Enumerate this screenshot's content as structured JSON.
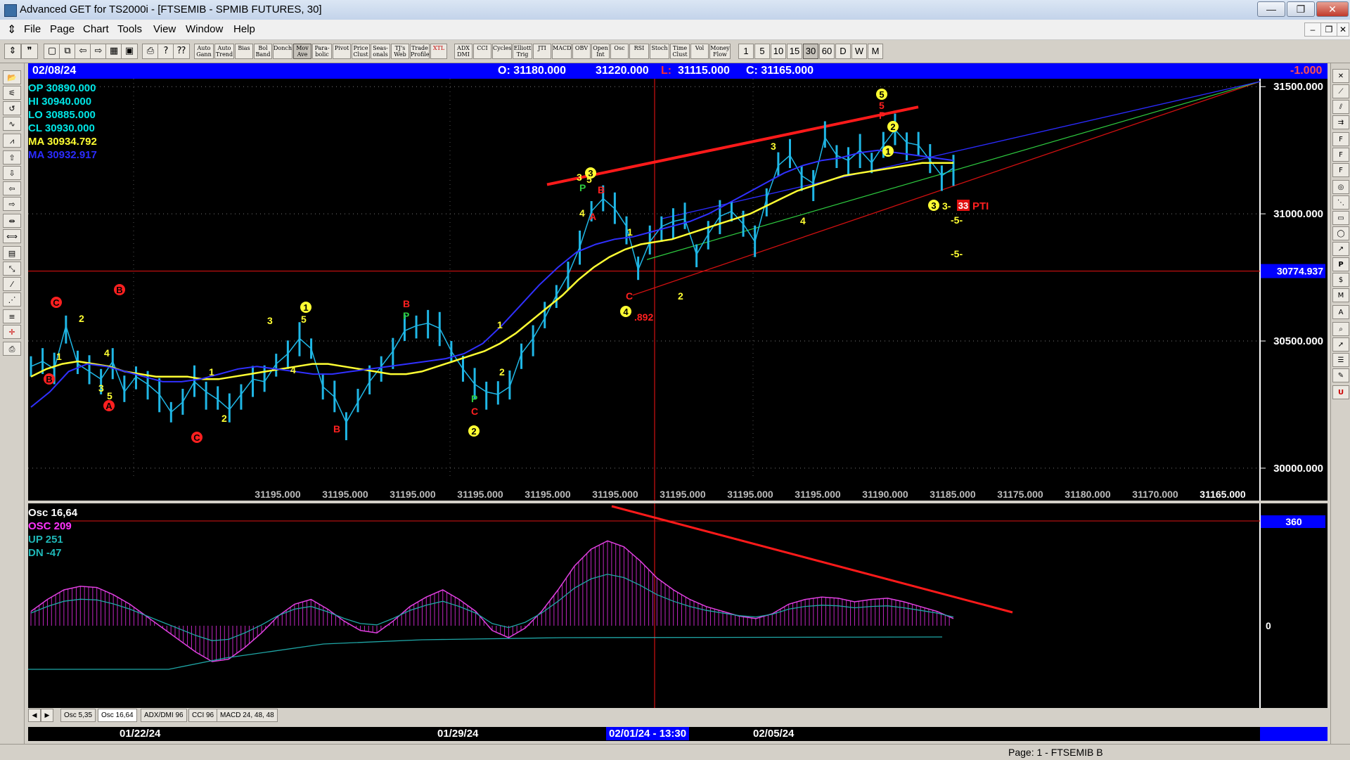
{
  "window": {
    "title": "Advanced GET for TS2000i - [FTSEMIB - SPMIB FUTURES, 30]",
    "min": "—",
    "max": "❐",
    "close": "✕"
  },
  "menu": {
    "items": [
      "File",
      "Page",
      "Chart",
      "Tools",
      "View",
      "Window",
      "Help"
    ],
    "mdi": [
      "–",
      "❐",
      "✕"
    ]
  },
  "toolbar": {
    "buttons": [
      "Auto Gann",
      "Auto Trend",
      "Bias",
      "Bol Band",
      "Donch",
      "Mov Ave",
      "Para-bolic",
      "Pivot",
      "Price Clust",
      "Seas-onals",
      "TJ's Web",
      "Trade Profile",
      "XTL",
      "ADX DMI",
      "CCI",
      "Cycles",
      "Elliott Trig",
      "JTI",
      "MACD",
      "OBV",
      "Open Int",
      "Osc",
      "RSI",
      "Stoch",
      "Time Clust",
      "Vol",
      "Money Flow"
    ],
    "timeframes": [
      "1",
      "5",
      "10",
      "15",
      "30",
      "60",
      "D",
      "W",
      "M"
    ],
    "active_timeframe": "30"
  },
  "infobar": {
    "date": "02/08/24",
    "open": "O: 31180.000",
    "high": "31220.000",
    "low_label": "L:",
    "low": "31115.000",
    "close": "C: 31165.000",
    "change": "-1.000"
  },
  "databox": {
    "op": "OP  30890.000",
    "hi": "HI   30940.000",
    "lo": "LO  30885.000",
    "cl": "CL  30930.000",
    "ma1": "MA  30934.792",
    "ma2": "MA  30932.917"
  },
  "chart_data": {
    "type": "line",
    "title": "",
    "y_axis_ticks": [
      "31500.000",
      "31000.000",
      "30500.000",
      "30000.000"
    ],
    "ylim": [
      29950,
      31520
    ],
    "cursor_price": "30774.937",
    "bottom_price_labels": [
      "31195.000",
      "31195.000",
      "31195.000",
      "31195.000",
      "31195.000",
      "31195.000",
      "31195.000",
      "31195.000",
      "31195.000",
      "31190.000",
      "31185.000",
      "31175.000",
      "31180.000",
      "31170.000",
      "31165.000"
    ],
    "dates": [
      "01/22/24",
      "01/29/24",
      "02/01/24 - 13:30",
      "02/05/24"
    ],
    "series": [
      {
        "name": "Price",
        "color": "#1fb7e6",
        "values": [
          30400,
          30420,
          30390,
          30560,
          30410,
          30380,
          30350,
          30420,
          30300,
          30360,
          30330,
          30290,
          30220,
          30260,
          30340,
          30300,
          30270,
          30230,
          30290,
          30350,
          30340,
          30410,
          30450,
          30510,
          30470,
          30320,
          30280,
          30180,
          30260,
          30340,
          30400,
          30460,
          30540,
          30560,
          30570,
          30550,
          30460,
          30390,
          30330,
          30300,
          30290,
          30320,
          30450,
          30510,
          30590,
          30680,
          30760,
          30870,
          31010,
          31060,
          31020,
          30950,
          30780,
          30890,
          30950,
          30970,
          30980,
          30840,
          30920,
          30990,
          31010,
          30960,
          30890,
          31060,
          31190,
          31230,
          31150,
          31120,
          31300,
          31230,
          31210,
          31250,
          31200,
          31270,
          31330,
          31280,
          31270,
          31210,
          31150,
          31180
        ]
      },
      {
        "name": "",
        "color": "#ffff33",
        "values": [
          30360,
          30390,
          30410,
          30420,
          30410,
          30400,
          30380,
          30370,
          30360,
          30360,
          30360,
          30350,
          30350,
          30360,
          30370,
          30380,
          30390,
          30400,
          30410,
          30410,
          30400,
          30390,
          30380,
          30370,
          30370,
          30380,
          30400,
          30420,
          30440,
          30460,
          30490,
          30530,
          30580,
          30630,
          30680,
          30740,
          30790,
          30830,
          30860,
          30880,
          30890,
          30900,
          30920,
          30940,
          30960,
          30980,
          31000,
          31030,
          31060,
          31090,
          31110,
          31130,
          31150,
          31160,
          31170,
          31180,
          31190,
          31200,
          31200,
          31200
        ]
      },
      {
        "name": "",
        "color": "#3030ff",
        "values": [
          30240,
          30300,
          30380,
          30410,
          30400,
          30380,
          30360,
          30340,
          30340,
          30350,
          30370,
          30390,
          30400,
          30390,
          30380,
          30370,
          30370,
          30380,
          30390,
          30400,
          30410,
          30420,
          30430,
          30450,
          30490,
          30560,
          30640,
          30720,
          30790,
          30850,
          30880,
          30900,
          30910,
          30930,
          30950,
          30970,
          31000,
          31040,
          31080,
          31120,
          31160,
          31190,
          31210,
          31220,
          31240,
          31250,
          31240,
          31230,
          31220,
          31210
        ]
      }
    ],
    "wave_labels": [
      "1",
      "2",
      "3",
      "4",
      "5",
      "A",
      "B",
      "C",
      "P"
    ],
    "annotations": [
      ".892",
      "PTI",
      "33",
      "-5-",
      "3-"
    ]
  },
  "osc": {
    "title": "Osc 16,64",
    "osc": "OSC 209",
    "up": "UP    251",
    "dn": "DN    -47",
    "marker": "360",
    "zero": "0",
    "chart_data": {
      "type": "bar",
      "title": "",
      "values": [
        60,
        110,
        150,
        165,
        160,
        130,
        90,
        40,
        -10,
        -60,
        -110,
        -150,
        -140,
        -90,
        -30,
        40,
        90,
        110,
        70,
        20,
        -20,
        -30,
        20,
        80,
        120,
        150,
        110,
        60,
        -20,
        -50,
        -10,
        60,
        150,
        250,
        320,
        355,
        330,
        270,
        200,
        150,
        110,
        80,
        60,
        40,
        30,
        50,
        90,
        110,
        120,
        115,
        100,
        110,
        115,
        100,
        80,
        60,
        30
      ]
    }
  },
  "tabs": [
    "Osc 5,35",
    "Osc 16,64",
    "ADX/DMI 96",
    "CCI 96",
    "MACD 24, 48, 48"
  ],
  "active_tab": "Osc 16,64",
  "status": "Page: 1 - FTSEMIB B"
}
